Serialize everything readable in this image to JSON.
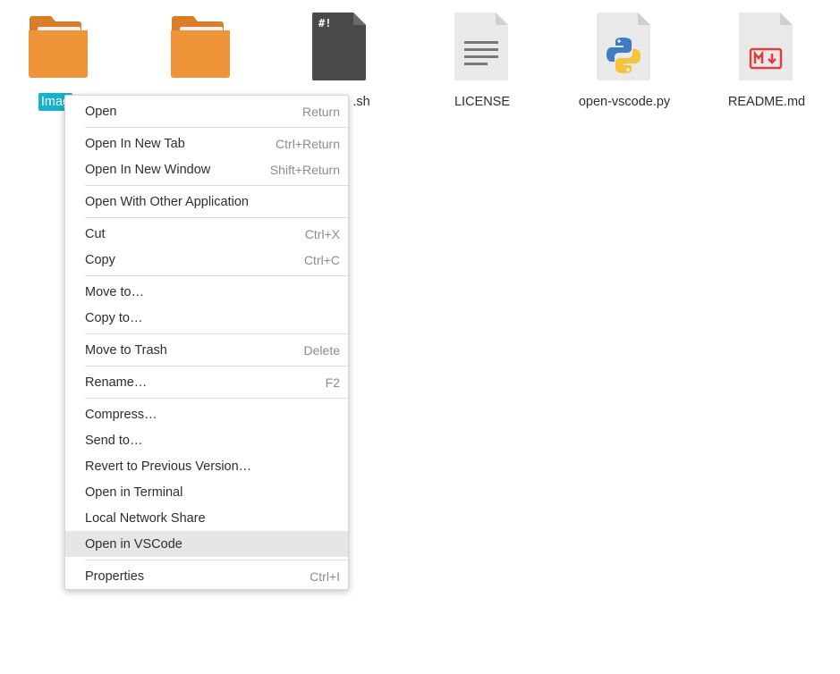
{
  "files": [
    {
      "name": "Images",
      "label_visible": "Imag",
      "type": "folder",
      "icon": "folder-icon",
      "selected": true
    },
    {
      "name": "",
      "type": "folder",
      "icon": "folder-icon",
      "selected": false
    },
    {
      "name": ".sh",
      "type": "script",
      "icon": "shell-script-icon",
      "glyph": "#!",
      "selected": false
    },
    {
      "name": "LICENSE",
      "type": "text",
      "icon": "text-file-icon",
      "selected": false
    },
    {
      "name": "open-vscode.py",
      "type": "python",
      "icon": "python-file-icon",
      "selected": false
    },
    {
      "name": "README.md",
      "type": "markdown",
      "icon": "markdown-file-icon",
      "glyph": "M↓",
      "selected": false
    }
  ],
  "menu": {
    "groups": [
      [
        {
          "label": "Open",
          "accel": "Return"
        }
      ],
      [
        {
          "label": "Open In New Tab",
          "accel": "Ctrl+Return"
        },
        {
          "label": "Open In New Window",
          "accel": "Shift+Return"
        }
      ],
      [
        {
          "label": "Open With Other Application",
          "accel": ""
        }
      ],
      [
        {
          "label": "Cut",
          "accel": "Ctrl+X"
        },
        {
          "label": "Copy",
          "accel": "Ctrl+C"
        }
      ],
      [
        {
          "label": "Move to…",
          "accel": ""
        },
        {
          "label": "Copy to…",
          "accel": ""
        }
      ],
      [
        {
          "label": "Move to Trash",
          "accel": "Delete"
        }
      ],
      [
        {
          "label": "Rename…",
          "accel": "F2"
        }
      ],
      [
        {
          "label": "Compress…",
          "accel": ""
        },
        {
          "label": "Send to…",
          "accel": ""
        },
        {
          "label": "Revert to Previous Version…",
          "accel": ""
        },
        {
          "label": "Open in Terminal",
          "accel": ""
        },
        {
          "label": "Local Network Share",
          "accel": ""
        },
        {
          "label": "Open in VSCode",
          "accel": "",
          "highlighted": true
        }
      ],
      [
        {
          "label": "Properties",
          "accel": "Ctrl+I"
        }
      ]
    ]
  },
  "colors": {
    "folder": "#ef9439",
    "folder_dark": "#d97e26",
    "selection": "#14b3cf",
    "script_bg": "#4a4a4a",
    "doc_bg": "#e9e9e9",
    "markdown_red": "#d94040",
    "python_blue": "#3f7cc1",
    "python_yellow": "#f7c33d",
    "menu_highlight": "#e6e6e7"
  }
}
